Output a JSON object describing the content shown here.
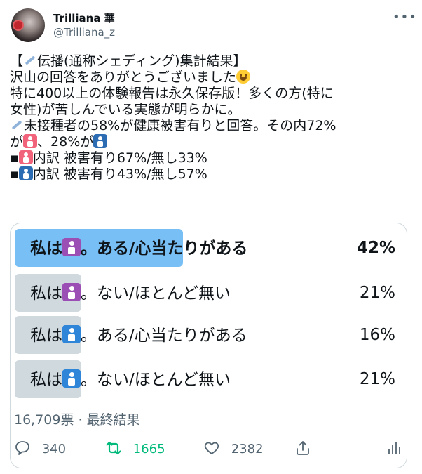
{
  "user": {
    "name": "Trilliana 華",
    "handle": "@Trilliana_z"
  },
  "tweet": {
    "lines": [
      {
        "pre": "【",
        "emoji": "syringe",
        "post": "伝播(通称シェディング)集計結果】"
      },
      {
        "pre": "沢山の回答をありがとうございました",
        "emoji": "smile",
        "post": ""
      },
      {
        "pre": "特に400以上の体験報告は永久保存版！多くの方(特に",
        "emoji": "",
        "post": ""
      },
      {
        "pre": "女性)が苦しんでいる実態が明らかに。",
        "emoji": "",
        "post": ""
      },
      {
        "pre": "",
        "emoji": "syringe",
        "post": "未接種者の58%が健康被害有りと回答。その内72%"
      },
      {
        "pre": "が",
        "emoji": "woman",
        "post": "、28%が",
        "emoji2": "man"
      },
      {
        "pre": "▪",
        "emoji": "woman",
        "post": "内訳 被害有り67%/無し33%"
      },
      {
        "pre": "▪",
        "emoji": "man",
        "post": "内訳 被害有り43%/無し57%"
      }
    ]
  },
  "poll": {
    "options": [
      {
        "pre": "私は",
        "icon": "woman",
        "post": "。ある/心当たりがある",
        "percent": "42%",
        "value": 42,
        "winner": true
      },
      {
        "pre": "私は",
        "icon": "woman",
        "post": "。ない/ほとんど無い",
        "percent": "21%",
        "value": 21,
        "winner": false
      },
      {
        "pre": "私は",
        "icon": "man",
        "post": "。ある/心当たりがある",
        "percent": "16%",
        "value": 16,
        "winner": false
      },
      {
        "pre": "私は",
        "icon": "man",
        "post": "。ない/ほとんど無い",
        "percent": "21%",
        "value": 21,
        "winner": false
      }
    ],
    "meta": "16,709票 · 最終結果"
  },
  "actions": {
    "reply_count": "340",
    "retweet_count": "1665",
    "like_count": "2382"
  },
  "colors": {
    "winner_bar": "#78bff5",
    "bar": "#cfd9de",
    "retweet": "#00ba7c"
  }
}
